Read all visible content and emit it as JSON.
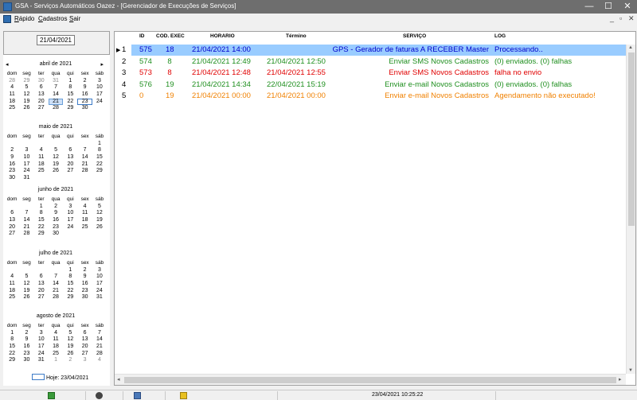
{
  "window": {
    "title": "GSA - Serviços Automáticos Oazez - [Gerenciador de Execuções de Serviços]",
    "minimize": "—",
    "maximize": "☐",
    "close": "✕",
    "mdi_min": "_",
    "mdi_restore": "▫",
    "mdi_close": "✕"
  },
  "menu": {
    "items": [
      {
        "label": "Rápido",
        "accel": "R",
        "rest": "ápido"
      },
      {
        "label": "Cadastros",
        "accel": "C",
        "rest": "adastros"
      },
      {
        "label": "Sair",
        "accel": "S",
        "rest": "air"
      }
    ]
  },
  "date_field": {
    "value": "21/04/2021"
  },
  "calendar": {
    "weekdays": [
      "dom",
      "seg",
      "ter",
      "qua",
      "qui",
      "sex",
      "sáb"
    ],
    "prev": "◂",
    "next": "▸",
    "months": [
      {
        "title": "abril de 2021",
        "days": [
          [
            "28",
            "dim"
          ],
          [
            "29",
            "dim"
          ],
          [
            "30",
            "dim"
          ],
          [
            "31",
            "dim"
          ],
          [
            "1",
            ""
          ],
          [
            "2",
            ""
          ],
          [
            "3",
            ""
          ],
          [
            "4",
            ""
          ],
          [
            "5",
            ""
          ],
          [
            "6",
            ""
          ],
          [
            "7",
            ""
          ],
          [
            "8",
            ""
          ],
          [
            "9",
            ""
          ],
          [
            "10",
            ""
          ],
          [
            "11",
            ""
          ],
          [
            "12",
            ""
          ],
          [
            "13",
            ""
          ],
          [
            "14",
            ""
          ],
          [
            "15",
            ""
          ],
          [
            "16",
            ""
          ],
          [
            "17",
            ""
          ],
          [
            "18",
            ""
          ],
          [
            "19",
            ""
          ],
          [
            "20",
            ""
          ],
          [
            "21",
            "sel"
          ],
          [
            "22",
            ""
          ],
          [
            "23",
            "today"
          ],
          [
            "24",
            ""
          ],
          [
            "25",
            ""
          ],
          [
            "26",
            ""
          ],
          [
            "27",
            ""
          ],
          [
            "28",
            ""
          ],
          [
            "29",
            ""
          ],
          [
            "30",
            ""
          ],
          [
            "",
            ""
          ]
        ]
      },
      {
        "title": "maio de 2021",
        "days": [
          [
            "",
            ""
          ],
          [
            "",
            ""
          ],
          [
            "",
            ""
          ],
          [
            "",
            ""
          ],
          [
            "",
            ""
          ],
          [
            "",
            ""
          ],
          [
            "1",
            ""
          ],
          [
            "2",
            ""
          ],
          [
            "3",
            ""
          ],
          [
            "4",
            ""
          ],
          [
            "5",
            ""
          ],
          [
            "6",
            ""
          ],
          [
            "7",
            ""
          ],
          [
            "8",
            ""
          ],
          [
            "9",
            ""
          ],
          [
            "10",
            ""
          ],
          [
            "11",
            ""
          ],
          [
            "12",
            ""
          ],
          [
            "13",
            ""
          ],
          [
            "14",
            ""
          ],
          [
            "15",
            ""
          ],
          [
            "16",
            ""
          ],
          [
            "17",
            ""
          ],
          [
            "18",
            ""
          ],
          [
            "19",
            ""
          ],
          [
            "20",
            ""
          ],
          [
            "21",
            ""
          ],
          [
            "22",
            ""
          ],
          [
            "23",
            ""
          ],
          [
            "24",
            ""
          ],
          [
            "25",
            ""
          ],
          [
            "26",
            ""
          ],
          [
            "27",
            ""
          ],
          [
            "28",
            ""
          ],
          [
            "29",
            ""
          ],
          [
            "30",
            ""
          ],
          [
            "31",
            ""
          ]
        ]
      },
      {
        "title": "junho de 2021",
        "days": [
          [
            "",
            ""
          ],
          [
            "",
            ""
          ],
          [
            "1",
            ""
          ],
          [
            "2",
            ""
          ],
          [
            "3",
            ""
          ],
          [
            "4",
            ""
          ],
          [
            "5",
            ""
          ],
          [
            "6",
            ""
          ],
          [
            "7",
            ""
          ],
          [
            "8",
            ""
          ],
          [
            "9",
            ""
          ],
          [
            "10",
            ""
          ],
          [
            "11",
            ""
          ],
          [
            "12",
            ""
          ],
          [
            "13",
            ""
          ],
          [
            "14",
            ""
          ],
          [
            "15",
            ""
          ],
          [
            "16",
            ""
          ],
          [
            "17",
            ""
          ],
          [
            "18",
            ""
          ],
          [
            "19",
            ""
          ],
          [
            "20",
            ""
          ],
          [
            "21",
            ""
          ],
          [
            "22",
            ""
          ],
          [
            "23",
            ""
          ],
          [
            "24",
            ""
          ],
          [
            "25",
            ""
          ],
          [
            "26",
            ""
          ],
          [
            "27",
            ""
          ],
          [
            "28",
            ""
          ],
          [
            "29",
            ""
          ],
          [
            "30",
            ""
          ]
        ]
      },
      {
        "title": "julho de 2021",
        "days": [
          [
            "",
            ""
          ],
          [
            "",
            ""
          ],
          [
            "",
            ""
          ],
          [
            "",
            ""
          ],
          [
            "1",
            ""
          ],
          [
            "2",
            ""
          ],
          [
            "3",
            ""
          ],
          [
            "4",
            ""
          ],
          [
            "5",
            ""
          ],
          [
            "6",
            ""
          ],
          [
            "7",
            ""
          ],
          [
            "8",
            ""
          ],
          [
            "9",
            ""
          ],
          [
            "10",
            ""
          ],
          [
            "11",
            ""
          ],
          [
            "12",
            ""
          ],
          [
            "13",
            ""
          ],
          [
            "14",
            ""
          ],
          [
            "15",
            ""
          ],
          [
            "16",
            ""
          ],
          [
            "17",
            ""
          ],
          [
            "18",
            ""
          ],
          [
            "19",
            ""
          ],
          [
            "20",
            ""
          ],
          [
            "21",
            ""
          ],
          [
            "22",
            ""
          ],
          [
            "23",
            ""
          ],
          [
            "24",
            ""
          ],
          [
            "25",
            ""
          ],
          [
            "26",
            ""
          ],
          [
            "27",
            ""
          ],
          [
            "28",
            ""
          ],
          [
            "29",
            ""
          ],
          [
            "30",
            ""
          ],
          [
            "31",
            ""
          ]
        ]
      },
      {
        "title": "agosto de 2021",
        "days": [
          [
            "1",
            ""
          ],
          [
            "2",
            ""
          ],
          [
            "3",
            ""
          ],
          [
            "4",
            ""
          ],
          [
            "5",
            ""
          ],
          [
            "6",
            ""
          ],
          [
            "7",
            ""
          ],
          [
            "8",
            ""
          ],
          [
            "9",
            ""
          ],
          [
            "10",
            ""
          ],
          [
            "11",
            ""
          ],
          [
            "12",
            ""
          ],
          [
            "13",
            ""
          ],
          [
            "14",
            ""
          ],
          [
            "15",
            ""
          ],
          [
            "16",
            ""
          ],
          [
            "17",
            ""
          ],
          [
            "18",
            ""
          ],
          [
            "19",
            ""
          ],
          [
            "20",
            ""
          ],
          [
            "21",
            ""
          ],
          [
            "22",
            ""
          ],
          [
            "23",
            ""
          ],
          [
            "24",
            ""
          ],
          [
            "25",
            ""
          ],
          [
            "26",
            ""
          ],
          [
            "27",
            ""
          ],
          [
            "28",
            ""
          ],
          [
            "29",
            ""
          ],
          [
            "30",
            ""
          ],
          [
            "31",
            ""
          ],
          [
            "1",
            "dim"
          ],
          [
            "2",
            "dim"
          ],
          [
            "3",
            "dim"
          ],
          [
            "4",
            "dim"
          ]
        ]
      }
    ],
    "today_label": "Hoje: 23/04/2021"
  },
  "grid": {
    "columns": [
      "ID",
      "COD. EXEC",
      "HORARIO",
      "Término",
      "SERVIÇO",
      "LOG"
    ],
    "rows": [
      {
        "num": "1",
        "id": "575",
        "cod": "18",
        "horario": "21/04/2021 14:00",
        "termino": "",
        "servico": "GPS - Gerador de faturas A RECEBER Master",
        "log": "Processando..",
        "color": "#0000cc",
        "selected": true
      },
      {
        "num": "2",
        "id": "574",
        "cod": "8",
        "horario": "21/04/2021 12:49",
        "termino": "21/04/2021 12:50",
        "servico": "Enviar SMS Novos Cadastros",
        "log": "(0) enviados. (0) falhas",
        "color": "#1f8f1f",
        "selected": false
      },
      {
        "num": "3",
        "id": "573",
        "cod": "8",
        "horario": "21/04/2021 12:48",
        "termino": "21/04/2021 12:55",
        "servico": "Enviar SMS Novos Cadastros",
        "log": "falha no envio",
        "color": "#e00000",
        "selected": false
      },
      {
        "num": "4",
        "id": "576",
        "cod": "19",
        "horario": "21/04/2021 14:34",
        "termino": "22/04/2021 15:19",
        "servico": "Enviar e-mail Novos Cadastros",
        "log": "(0) enviados. (0) falhas",
        "color": "#1f8f1f",
        "selected": false
      },
      {
        "num": "5",
        "id": "0",
        "cod": "19",
        "horario": "21/04/2021 00:00",
        "termino": "21/04/2021 00:00",
        "servico": "Enviar e-mail Novos Cadastros",
        "log": "Agendamento não executado!",
        "color": "#f08000",
        "selected": false
      }
    ]
  },
  "status": {
    "datetime": "23/04/2021 10:25:22"
  }
}
